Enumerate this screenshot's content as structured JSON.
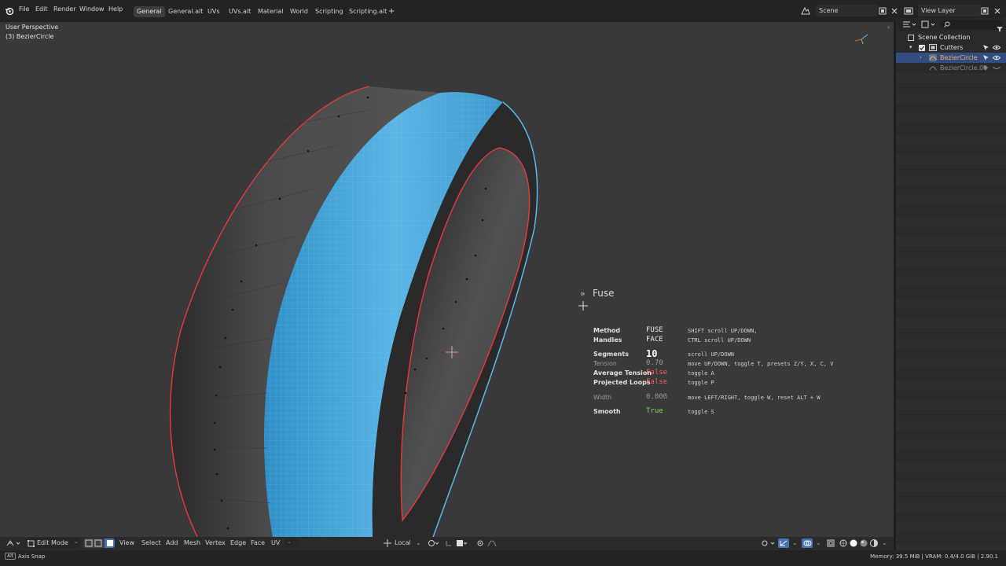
{
  "menu": [
    "File",
    "Edit",
    "Render",
    "Window",
    "Help"
  ],
  "workspaces": [
    {
      "label": "General",
      "active": true
    },
    {
      "label": "General.alt",
      "active": false
    },
    {
      "label": "UVs",
      "active": false
    },
    {
      "label": "UVs.alt",
      "active": false
    },
    {
      "label": "Material",
      "active": false
    },
    {
      "label": "World",
      "active": false
    },
    {
      "label": "Scripting",
      "active": false
    },
    {
      "label": "Scripting.alt",
      "active": false
    }
  ],
  "add_tab": "+",
  "scene": {
    "label": "Scene"
  },
  "view_layer": {
    "label": "View Layer"
  },
  "viewport": {
    "perspective": "User Perspective",
    "object": "(3) BezierCircle"
  },
  "outliner": {
    "search_placeholder": "",
    "scene_collection": "Scene Collection",
    "rows": [
      {
        "label": "Cutters",
        "selected": false
      },
      {
        "label": "BezierCircle",
        "selected": true
      },
      {
        "label": "BezierCircle.00",
        "selected": false
      }
    ]
  },
  "hud": {
    "title": "Fuse",
    "rows": [
      {
        "key": "Method",
        "value": "FUSE",
        "hint": "SHIFT scroll UP/DOWN,",
        "dim": false,
        "value_color": "#e8e8e8",
        "large": false
      },
      {
        "key": "Handles",
        "value": "FACE",
        "hint": "CTRL scroll UP/DOWN",
        "dim": false,
        "value_color": "#e8e8e8",
        "large": false
      },
      {
        "key": "Segments",
        "value": "10",
        "hint": "scroll UP/DOWN",
        "dim": false,
        "value_color": "#ffffff",
        "large": true
      },
      {
        "key": "Tension",
        "value": "0.70",
        "hint": "move UP/DOWN, toggle T, presets Z/Y, X, C, V",
        "dim": true,
        "value_color": "#9a9a9a",
        "large": false
      },
      {
        "key": "Average Tension",
        "value": "False",
        "hint": "toggle A",
        "dim": false,
        "value_color": "#ff5a5a",
        "large": false
      },
      {
        "key": "Projected Loops",
        "value": "False",
        "hint": "toggle P",
        "dim": false,
        "value_color": "#ff5a5a",
        "large": false
      },
      {
        "key": "Width",
        "value": "0.000",
        "hint": "move LEFT/RIGHT, toggle W, reset ALT + W",
        "dim": true,
        "value_color": "#9a9a9a",
        "large": false
      },
      {
        "key": "Smooth",
        "value": "True",
        "hint": "toggle S",
        "dim": false,
        "value_color": "#7ddc5a",
        "large": false
      }
    ]
  },
  "bottom": {
    "mode": "Edit Mode",
    "menus": [
      "View",
      "Select",
      "Add",
      "Mesh",
      "Vertex",
      "Edge",
      "Face",
      "UV"
    ],
    "pivot": "Local"
  },
  "status": {
    "left_key": "Alt",
    "left_label": "Axis Snap",
    "right": "Memory: 39.5 MiB | VRAM: 0.4/4.0 GiB | 2.90.1"
  },
  "colors": {
    "accent": "#4772b3",
    "selection_red": "#e83a3a",
    "selected_face": "#4aa6d8"
  }
}
